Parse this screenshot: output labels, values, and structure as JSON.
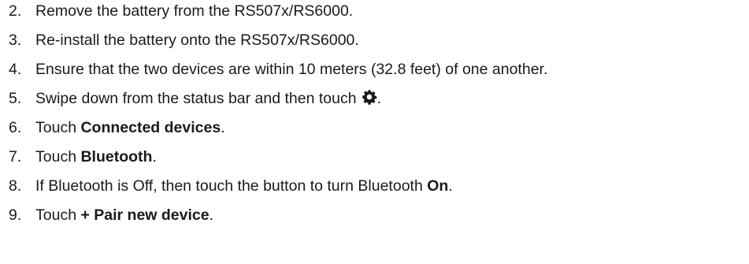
{
  "steps": [
    {
      "number": "2.",
      "text": "Remove the battery from the RS507x/RS6000."
    },
    {
      "number": "3.",
      "text": "Re-install the battery onto the RS507x/RS6000."
    },
    {
      "number": "4.",
      "text": "Ensure that the two devices are within 10 meters (32.8 feet) of one another."
    },
    {
      "number": "5.",
      "text_before": "Swipe down from the status bar and then touch",
      "icon": "gear-icon",
      "text_after": "."
    },
    {
      "number": "6.",
      "text_before": "Touch ",
      "bold": "Connected devices",
      "text_after": "."
    },
    {
      "number": "7.",
      "text_before": "Touch ",
      "bold": "Bluetooth",
      "text_after": "."
    },
    {
      "number": "8.",
      "text_before": "If Bluetooth is Off, then touch the button to turn Bluetooth ",
      "bold": "On",
      "text_after": "."
    },
    {
      "number": "9.",
      "text_before": "Touch ",
      "bold": "+ Pair new device",
      "text_after": "."
    }
  ]
}
